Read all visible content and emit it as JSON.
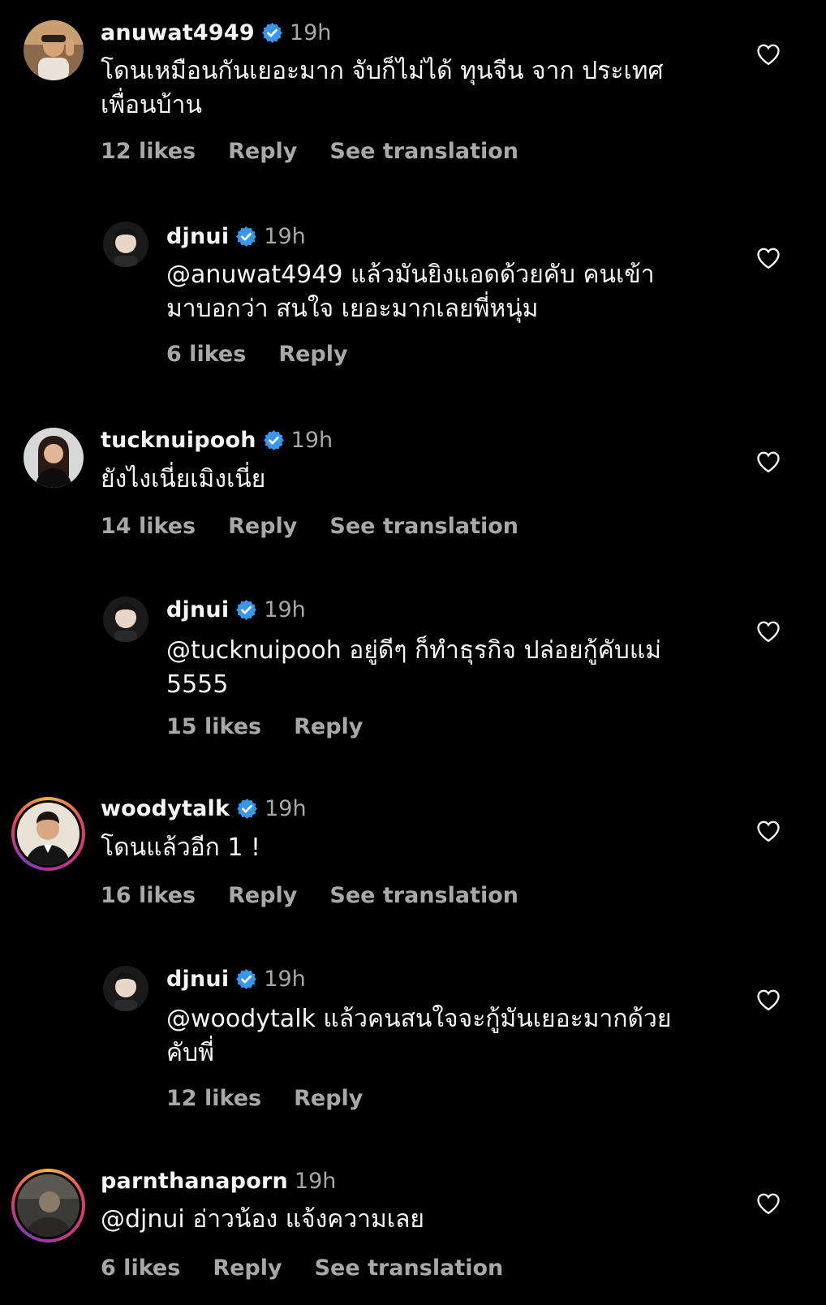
{
  "comments": [
    {
      "username": "anuwat4949",
      "verified": true,
      "time": "19h",
      "text": "โดนเหมือนกันเยอะมาก จับก็ไม่ได้ ทุนจีน จาก ประเทศเพื่อนบ้าน",
      "likes": "12 likes",
      "reply": "Reply",
      "translate": "See translation"
    },
    {
      "username": "djnui",
      "verified": true,
      "time": "19h",
      "text": "@anuwat4949 แล้วมันยิงแอดด้วยคับ  คนเข้ามาบอกว่า สนใจ  เยอะมากเลยพี่หนุ่ม",
      "likes": "6 likes",
      "reply": "Reply"
    },
    {
      "username": "tucknuipooh",
      "verified": true,
      "time": "19h",
      "text": "ยังไงเนี่ยเมิงเนี่ย",
      "likes": "14 likes",
      "reply": "Reply",
      "translate": "See translation"
    },
    {
      "username": "djnui",
      "verified": true,
      "time": "19h",
      "text": "@tucknuipooh อยู่ดีๆ ก็ทำธุรกิจ ปล่อยกู้คับแม่ 5555",
      "likes": "15 likes",
      "reply": "Reply"
    },
    {
      "username": "woodytalk",
      "verified": true,
      "time": "19h",
      "text": "โดนแล้วอีก 1 !",
      "likes": "16 likes",
      "reply": "Reply",
      "translate": "See translation"
    },
    {
      "username": "djnui",
      "verified": true,
      "time": "19h",
      "text": "@woodytalk แล้วคนสนใจจะกู้มันเยอะมากด้วยคับพี่",
      "likes": "12 likes",
      "reply": "Reply"
    },
    {
      "username": "parnthanaporn",
      "verified": false,
      "time": "19h",
      "text": "@djnui อ่าวน้อง แจ้งความเลย",
      "likes": "6 likes",
      "reply": "Reply",
      "translate": "See translation"
    }
  ],
  "colors": {
    "background": "#000000",
    "text": "#f5f5f5",
    "secondary": "#a8a8a8",
    "verified": "#3897f0"
  },
  "icons": {
    "verified": "verified-badge-icon",
    "like": "heart-outline-icon"
  }
}
